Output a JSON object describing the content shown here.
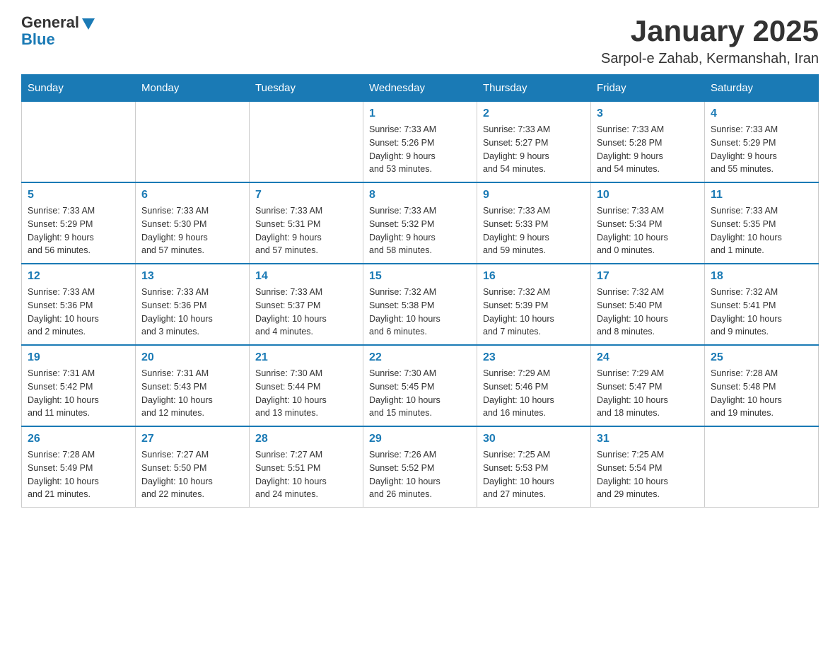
{
  "header": {
    "logo_general": "General",
    "logo_blue": "Blue",
    "title": "January 2025",
    "subtitle": "Sarpol-e Zahab, Kermanshah, Iran"
  },
  "days_of_week": [
    "Sunday",
    "Monday",
    "Tuesday",
    "Wednesday",
    "Thursday",
    "Friday",
    "Saturday"
  ],
  "weeks": [
    [
      {
        "day": "",
        "info": ""
      },
      {
        "day": "",
        "info": ""
      },
      {
        "day": "",
        "info": ""
      },
      {
        "day": "1",
        "info": "Sunrise: 7:33 AM\nSunset: 5:26 PM\nDaylight: 9 hours\nand 53 minutes."
      },
      {
        "day": "2",
        "info": "Sunrise: 7:33 AM\nSunset: 5:27 PM\nDaylight: 9 hours\nand 54 minutes."
      },
      {
        "day": "3",
        "info": "Sunrise: 7:33 AM\nSunset: 5:28 PM\nDaylight: 9 hours\nand 54 minutes."
      },
      {
        "day": "4",
        "info": "Sunrise: 7:33 AM\nSunset: 5:29 PM\nDaylight: 9 hours\nand 55 minutes."
      }
    ],
    [
      {
        "day": "5",
        "info": "Sunrise: 7:33 AM\nSunset: 5:29 PM\nDaylight: 9 hours\nand 56 minutes."
      },
      {
        "day": "6",
        "info": "Sunrise: 7:33 AM\nSunset: 5:30 PM\nDaylight: 9 hours\nand 57 minutes."
      },
      {
        "day": "7",
        "info": "Sunrise: 7:33 AM\nSunset: 5:31 PM\nDaylight: 9 hours\nand 57 minutes."
      },
      {
        "day": "8",
        "info": "Sunrise: 7:33 AM\nSunset: 5:32 PM\nDaylight: 9 hours\nand 58 minutes."
      },
      {
        "day": "9",
        "info": "Sunrise: 7:33 AM\nSunset: 5:33 PM\nDaylight: 9 hours\nand 59 minutes."
      },
      {
        "day": "10",
        "info": "Sunrise: 7:33 AM\nSunset: 5:34 PM\nDaylight: 10 hours\nand 0 minutes."
      },
      {
        "day": "11",
        "info": "Sunrise: 7:33 AM\nSunset: 5:35 PM\nDaylight: 10 hours\nand 1 minute."
      }
    ],
    [
      {
        "day": "12",
        "info": "Sunrise: 7:33 AM\nSunset: 5:36 PM\nDaylight: 10 hours\nand 2 minutes."
      },
      {
        "day": "13",
        "info": "Sunrise: 7:33 AM\nSunset: 5:36 PM\nDaylight: 10 hours\nand 3 minutes."
      },
      {
        "day": "14",
        "info": "Sunrise: 7:33 AM\nSunset: 5:37 PM\nDaylight: 10 hours\nand 4 minutes."
      },
      {
        "day": "15",
        "info": "Sunrise: 7:32 AM\nSunset: 5:38 PM\nDaylight: 10 hours\nand 6 minutes."
      },
      {
        "day": "16",
        "info": "Sunrise: 7:32 AM\nSunset: 5:39 PM\nDaylight: 10 hours\nand 7 minutes."
      },
      {
        "day": "17",
        "info": "Sunrise: 7:32 AM\nSunset: 5:40 PM\nDaylight: 10 hours\nand 8 minutes."
      },
      {
        "day": "18",
        "info": "Sunrise: 7:32 AM\nSunset: 5:41 PM\nDaylight: 10 hours\nand 9 minutes."
      }
    ],
    [
      {
        "day": "19",
        "info": "Sunrise: 7:31 AM\nSunset: 5:42 PM\nDaylight: 10 hours\nand 11 minutes."
      },
      {
        "day": "20",
        "info": "Sunrise: 7:31 AM\nSunset: 5:43 PM\nDaylight: 10 hours\nand 12 minutes."
      },
      {
        "day": "21",
        "info": "Sunrise: 7:30 AM\nSunset: 5:44 PM\nDaylight: 10 hours\nand 13 minutes."
      },
      {
        "day": "22",
        "info": "Sunrise: 7:30 AM\nSunset: 5:45 PM\nDaylight: 10 hours\nand 15 minutes."
      },
      {
        "day": "23",
        "info": "Sunrise: 7:29 AM\nSunset: 5:46 PM\nDaylight: 10 hours\nand 16 minutes."
      },
      {
        "day": "24",
        "info": "Sunrise: 7:29 AM\nSunset: 5:47 PM\nDaylight: 10 hours\nand 18 minutes."
      },
      {
        "day": "25",
        "info": "Sunrise: 7:28 AM\nSunset: 5:48 PM\nDaylight: 10 hours\nand 19 minutes."
      }
    ],
    [
      {
        "day": "26",
        "info": "Sunrise: 7:28 AM\nSunset: 5:49 PM\nDaylight: 10 hours\nand 21 minutes."
      },
      {
        "day": "27",
        "info": "Sunrise: 7:27 AM\nSunset: 5:50 PM\nDaylight: 10 hours\nand 22 minutes."
      },
      {
        "day": "28",
        "info": "Sunrise: 7:27 AM\nSunset: 5:51 PM\nDaylight: 10 hours\nand 24 minutes."
      },
      {
        "day": "29",
        "info": "Sunrise: 7:26 AM\nSunset: 5:52 PM\nDaylight: 10 hours\nand 26 minutes."
      },
      {
        "day": "30",
        "info": "Sunrise: 7:25 AM\nSunset: 5:53 PM\nDaylight: 10 hours\nand 27 minutes."
      },
      {
        "day": "31",
        "info": "Sunrise: 7:25 AM\nSunset: 5:54 PM\nDaylight: 10 hours\nand 29 minutes."
      },
      {
        "day": "",
        "info": ""
      }
    ]
  ]
}
